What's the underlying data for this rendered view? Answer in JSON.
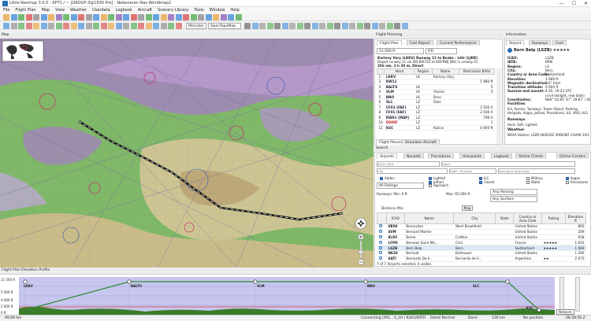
{
  "window": {
    "title": "Little Navmap 3.0.0 - KPT1 / ~  [GROUP:3@1930 Pro] - Nebeneum Nav Worldmap2"
  },
  "menu": [
    "File",
    "Flight Plan",
    "Map",
    "View",
    "Weather",
    "Userdata",
    "Logbook",
    "Aircraft",
    "Scenery Library",
    "Tools",
    "Window",
    "Help"
  ],
  "toolbar": {
    "projection": "Mercator",
    "theme": "OpenTopoMap"
  },
  "map": {
    "label": "Map"
  },
  "flight_plan": {
    "panel_label": "Flight Planning",
    "tabs": [
      "Flight Plan",
      "Fuel Report",
      "Current Performance"
    ],
    "cruise_altitude": "11.500 ft",
    "type": "IFR",
    "summary_line1": "Karlovy Vary (LKKV) Runway 11 to Bosko - Lětr (LJKR)",
    "summary_line2": "Depart runway 11 via SID BALT1Z  to B/D/RWJ [B0] in runway 01",
    "summary_line3": "356 nm, 3 h 30 m, Direct",
    "columns": [
      "Ident",
      "Region",
      "Name",
      "Restriction ft/kts"
    ],
    "rows": [
      {
        "ident": "LKKV",
        "region": "LK",
        "name": "Karlovy Vary",
        "restr": ""
      },
      {
        "ident": "RW11",
        "region": "",
        "name": "",
        "restr": "1 980 ft"
      },
      {
        "ident": "BALTU",
        "region": "LK",
        "name": "",
        "restr": "5"
      },
      {
        "ident": "VLM",
        "region": "LK",
        "name": "Vlasim",
        "restr": "5"
      },
      {
        "ident": "BNO",
        "region": "LK",
        "name": "Brno",
        "restr": ""
      },
      {
        "ident": "SLC",
        "region": "LZ",
        "name": "Sliac",
        "restr": ""
      },
      {
        "ident": "CF01 (FAF)",
        "region": "LZ",
        "name": "",
        "restr": "2 500 A"
      },
      {
        "ident": "FF01 (FAF)",
        "region": "LZ",
        "name": "",
        "restr": "2 500 A"
      },
      {
        "ident": "RW01 (MAP)",
        "region": "LZ",
        "name": "",
        "restr": "790 A"
      },
      {
        "ident": "D008F",
        "region": "LZ",
        "name": "",
        "restr": "1"
      },
      {
        "ident": "KSC",
        "region": "LZ",
        "name": "Kosice",
        "restr": "4 000 ft"
      }
    ],
    "bottom_tabs": [
      "Flight Planning",
      "Simulator Aircraft"
    ]
  },
  "info": {
    "panel_label": "Information",
    "tabs": [
      "Airport",
      "Runways",
      "Com"
    ],
    "airport_title": "Bern Belp (LSZB)",
    "stars": "★★★★★",
    "fields": [
      {
        "k": "ICAO:",
        "v": "LSZB"
      },
      {
        "k": "IATA:",
        "v": "BRN"
      },
      {
        "k": "Region:",
        "v": "LS"
      },
      {
        "k": "City:",
        "v": "Bern"
      },
      {
        "k": "Country or Area Code:",
        "v": "Switzerland"
      },
      {
        "k": "Elevation:",
        "v": "1 669 ft"
      },
      {
        "k": "Magnetic declination:",
        "v": "2.6° East"
      },
      {
        "k": "Transition altitude:",
        "v": "6 000 ft"
      },
      {
        "k": "Sunrise and sunset:",
        "v": "4:35, 19:23 UTC"
      },
      {
        "k": "",
        "v": "(civil twilight, real date)"
      },
      {
        "k": "Coordinates:",
        "v": "N46° 54.85' E7° 29.87' / 46.914°, 7.498°"
      }
    ],
    "facilities_label": "Facilities",
    "facilities": "ILS, Aprons, Taxiways, Tower Object, Parking, Helipads, Avgas, Jetfuel, Procedures, ILS, VASI, ALS",
    "runways_label": "Runways",
    "runways": "Hard, Soft, Lighted",
    "weather_label": "Weather",
    "weather_station": "NOAA Station: LSZB 060020Z VRB03KT CAVOK 10/10"
  },
  "search": {
    "panel_label": "Search",
    "tabs": [
      "Airports",
      "Navaids",
      "Procedures",
      "Userpoints",
      "Logbook",
      "Online Clients",
      "Online Centers"
    ],
    "ident_placeholder": "ICAO, IATA...",
    "name_placeholder": "Name",
    "city_placeholder": "City",
    "state_placeholder": "State / Province",
    "country_placeholder": "Country or Area Code",
    "checkboxes": [
      "Addon",
      "Lighted",
      "ILS",
      "Military",
      "Avgas",
      "Jetfuel",
      "Closed",
      "Water",
      "Procedures",
      "Helipads",
      "Approach"
    ],
    "ratings_combo": "All Ratings",
    "parking_combo": "Any Parking",
    "surface_combo": "Any Surface",
    "runway_label": "Runways: Min: 0 ft",
    "runway_max": "Max: 65 000 ft",
    "distance_label": "Distance",
    "distance_min": "Min:",
    "map_button": "Map",
    "columns": [
      "ICAO",
      "Name",
      "City",
      "State",
      "Country or Area Code",
      "Rating",
      "Elevation ft"
    ],
    "rows": [
      {
        "icao": "0B58",
        "name": "Bernardon",
        "city": "West Brookfield",
        "state": "",
        "country": "United States",
        "rating": "",
        "elev": "800"
      },
      {
        "icao": "4VM",
        "name": "Bernard Mamer",
        "city": "",
        "state": "",
        "country": "United States",
        "rating": "",
        "elev": "209"
      },
      {
        "icao": "8LR5",
        "name": "Berne",
        "city": "Crofton",
        "state": "",
        "country": "United States",
        "rating": "",
        "elev": "658"
      },
      {
        "icao": "LFPD",
        "name": "Bernaes Saint Ma...",
        "city": "Civil",
        "state": "",
        "country": "France",
        "rating": "★★★★★",
        "elev": "1 630"
      },
      {
        "icao": "LSZB",
        "name": "Bern Belp",
        "city": "Bern",
        "state": "",
        "country": "Switzerland",
        "rating": "★★★★★",
        "elev": "1 669"
      },
      {
        "icao": "NE20",
        "name": "Bernaid",
        "city": "Delmauer",
        "state": "",
        "country": "United States",
        "rating": "",
        "elev": "1 290"
      },
      {
        "icao": "SATI",
        "name": "Bernardo De Ir...",
        "city": "Bernardo de Ir...",
        "state": "",
        "country": "Argentina",
        "rating": "★★",
        "elev": "2 670"
      }
    ],
    "status": "7 of 7 Airports selected, 4 visible."
  },
  "profile": {
    "panel_label": "Flight Plan Elevation Profile",
    "altitudes": [
      "11 500 ft",
      "5 000 ft",
      "4 000 ft",
      "2 000 ft",
      "0 ft"
    ],
    "waypoints": [
      "LKKV",
      "BALTU",
      "VLM",
      "BNO",
      "SLC",
      "KSC"
    ],
    "bottom_label": "99,98 km"
  },
  "status": {
    "connection": "Connecting (XPL...",
    "coords": "V_Int / KLKV/KATR",
    "detail": "Detail Normal",
    "done": "Done",
    "distance": "126 km",
    "position": "No position",
    "tooltip": "Network",
    "time": "06:38:56 Z"
  },
  "colors": {
    "map_green": "#7fb867",
    "map_purple": "#a77ec8",
    "map_tan": "#d9c79a",
    "flightplan_black": "#111111",
    "profile_fill": "#c6c6ee",
    "profile_terrain": "#3a7c2a",
    "accent_blue": "#2a6fb3"
  },
  "icons": [
    "save-icon",
    "open-icon",
    "zoom-in-icon",
    "zoom-out-icon",
    "compass-icon",
    "airport-icon",
    "vor-icon",
    "ndb-icon"
  ]
}
